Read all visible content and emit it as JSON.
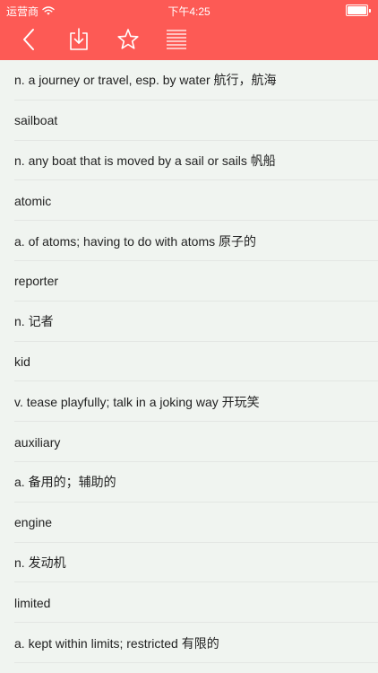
{
  "status_bar": {
    "carrier": "运营商",
    "time": "下午4:25",
    "battery_level": 1.0
  },
  "toolbar": {
    "back_icon": "chevron-left-icon",
    "download_icon": "download-tray-icon",
    "favorite_icon": "star-outline-icon",
    "list_icon": "list-lines-icon"
  },
  "colors": {
    "header": "#fd5a55",
    "background": "#f0f4f0",
    "text": "#222222",
    "divider": "#e3e6e3"
  },
  "entries": [
    "n. a journey or travel, esp. by water 航行，航海",
    "sailboat",
    "n. any boat that is moved by a sail or sails 帆船",
    "atomic",
    "a. of atoms; having to do with atoms 原子的",
    "reporter",
    "n. 记者",
    "kid",
    "v. tease playfully; talk in a joking way 开玩笑",
    "auxiliary",
    "a. 备用的；辅助的",
    "engine",
    "n. 发动机",
    "limited",
    "a. kept within limits; restricted 有限的"
  ]
}
